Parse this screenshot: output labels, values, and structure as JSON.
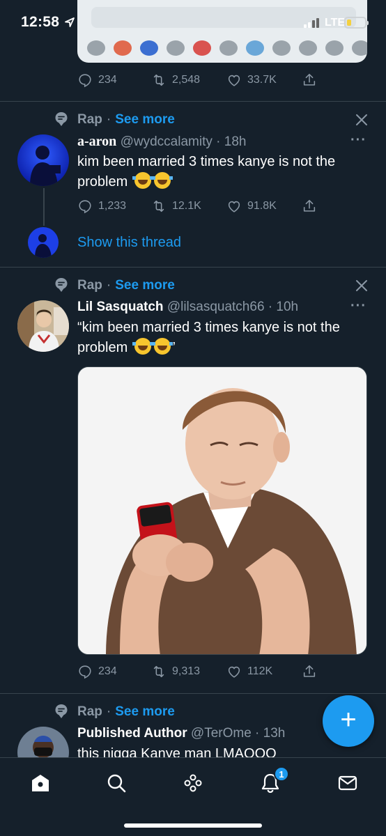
{
  "status_bar": {
    "time": "12:58",
    "network": "LTE",
    "icons": [
      "location-arrow-icon",
      "signal-icon",
      "battery-icon"
    ]
  },
  "colors": {
    "background": "#15202b",
    "accent": "#1d9bf0",
    "muted": "#8b98a5",
    "divider": "#38444d"
  },
  "tweets": [
    {
      "actions": {
        "reply": "234",
        "retweet": "2,548",
        "like": "33.7K"
      }
    },
    {
      "context": {
        "topic": "Rap",
        "separator": "·",
        "see_more": "See more"
      },
      "name": "a-aron",
      "handle": "@wydccalamity",
      "time": "· 18h",
      "text": "kim been married 3 times kanye is not the problem",
      "actions": {
        "reply": "1,233",
        "retweet": "12.1K",
        "like": "91.8K"
      },
      "show_thread": "Show this thread"
    },
    {
      "context": {
        "topic": "Rap",
        "separator": "·",
        "see_more": "See more"
      },
      "name": "Lil Sasquatch",
      "handle": "@lilsasquatch66",
      "time": "· 10h",
      "text_open": "“kim been married 3 times kanye is not the problem",
      "text_close": "”",
      "actions": {
        "reply": "234",
        "retweet": "9,313",
        "like": "112K"
      }
    },
    {
      "context": {
        "topic": "Rap",
        "separator": "·",
        "see_more": "See more"
      },
      "name": "Published Author",
      "handle": "@TerOme",
      "time": "· 13h",
      "text": "this nigga Kanye man LMAOOO"
    }
  ],
  "more_menu": "···",
  "compose_label": "+",
  "bottom_nav": {
    "items": [
      "home-icon",
      "search-icon",
      "spaces-icon",
      "notifications-icon",
      "messages-icon"
    ],
    "notifications_badge": "1"
  }
}
